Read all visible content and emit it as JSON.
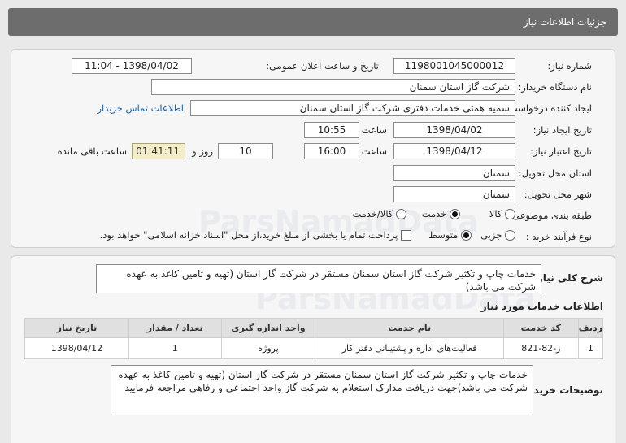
{
  "header": {
    "title": "جزئیات اطلاعات نیاز"
  },
  "form": {
    "need_number_label": "شماره نیاز:",
    "need_number": "1198001045000012",
    "announce_label": "تاریخ و ساعت اعلان عمومی:",
    "announce_value": "1398/04/02 - 11:04",
    "buyer_org_label": "نام دستگاه خریدار:",
    "buyer_org": "شرکت گاز استان سمنان",
    "requester_label": "ایجاد کننده درخواست:",
    "requester": "سمیه همتی خدمات دفتری شرکت گاز استان سمنان",
    "contact_link": "اطلاعات تماس خریدار",
    "created_label": "تاریخ ایجاد نیاز:",
    "created_date": "1398/04/02",
    "time_label": "ساعت",
    "created_time": "10:55",
    "valid_label": "تاریخ اعتبار نیاز:",
    "valid_date": "1398/04/12",
    "valid_time": "16:00",
    "days_value": "10",
    "days_label": "روز و",
    "remaining_time": "01:41:11",
    "remaining_label": "ساعت باقی مانده",
    "province_label": "استان محل تحویل:",
    "province": "سمنان",
    "city_label": "شهر محل تحویل:",
    "city": "سمنان",
    "category_label": "طبقه بندی موضوعی:",
    "category_options": [
      "کالا",
      "خدمت",
      "کالا/خدمت"
    ],
    "process_label": "نوع فرآیند خرید :",
    "process_options": [
      "جزیی",
      "متوسط"
    ],
    "payment_note": "پرداخت تمام یا بخشی از مبلغ خرید،از محل \"اسناد خزانه اسلامی\" خواهد بود."
  },
  "summary": {
    "label": "شرح کلی نیاز:",
    "text": "خدمات چاپ و تکثیر شرکت گاز استان سمنان مستقر در شرکت گاز استان (تهیه و تامین کاغذ به عهده شرکت می باشد)"
  },
  "services": {
    "title": "اطلاعات خدمات مورد نیاز",
    "columns": [
      "ردیف",
      "کد خدمت",
      "نام خدمت",
      "واحد اندازه گیری",
      "تعداد / مقدار",
      "تاریخ نیاز"
    ],
    "rows": [
      [
        "1",
        "ز-82-821",
        "فعالیت‌های اداره و پشتیبانی دفتر کار",
        "پروژه",
        "1",
        "1398/04/12"
      ]
    ]
  },
  "buyer_notes": {
    "label": "توضیحات خریدار:",
    "text": "خدمات چاپ و تکثیر شرکت گاز استان سمنان مستقر در شرکت گاز استان (تهیه و تامین کاغذ به عهده شرکت می باشد)جهت دریافت مدارک استعلام به شرکت گاز واحد اجتماعی و رفاهی مراجعه فرمایید"
  },
  "watermark": {
    "brand": "ParsNamadData"
  }
}
